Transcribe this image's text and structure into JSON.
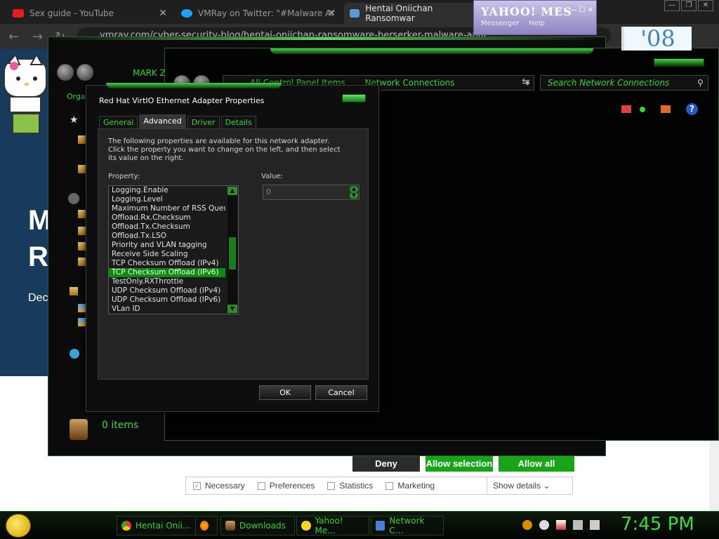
{
  "browser": {
    "tabs": [
      {
        "title": "Sex guide - YouTube",
        "icon": "youtube-icon",
        "active": false
      },
      {
        "title": "VMRay on Twitter: \"#Malware Ar",
        "icon": "twitter-icon",
        "active": false
      },
      {
        "title": "Hentai Oniichan Ransomwar",
        "icon": "vmray-icon",
        "active": true
      }
    ],
    "url": "vmray.com/cyber-security-blog/hentai-oniichan-ransomware-berserker-malware-anal"
  },
  "page": {
    "hero_letter_1": "M",
    "hero_letter_2": "R",
    "hero_sub": "Dec",
    "cookie": {
      "deny": "Deny",
      "allow_selection": "Allow selection",
      "allow_all": "Allow all",
      "checks": [
        {
          "label": "Necessary",
          "checked": true
        },
        {
          "label": "Preferences",
          "checked": false
        },
        {
          "label": "Statistics",
          "checked": false
        },
        {
          "label": "Marketing",
          "checked": false
        }
      ],
      "show_details": "Show details"
    }
  },
  "yahoo": {
    "brand": "YAHOO! MES",
    "messenger": "Messenger",
    "help": "Help",
    "badge": "'08"
  },
  "explorer_back": {
    "user_label": "MARK ZU",
    "organize": "Organ",
    "status": "0 items"
  },
  "explorer_front": {
    "breadcrumb": [
      "All Control Panel Items",
      "Network Connections"
    ],
    "search_placeholder": "Search Network Connections"
  },
  "dialog": {
    "title": "Red Hat VirtIO Ethernet Adapter Properties",
    "tabs": [
      "General",
      "Advanced",
      "Driver",
      "Details"
    ],
    "active_tab": "Advanced",
    "description": "The following properties are available for this network adapter. Click the property you want to change on the left, and then select its value on the right.",
    "property_label": "Property:",
    "value_label": "Value:",
    "properties": [
      "Logging.Enable",
      "Logging.Level",
      "Maximum Number of RSS Queues",
      "Offload.Rx.Checksum",
      "Offload.Tx.Checksum",
      "Offload.Tx.LSO",
      "Priority and VLAN tagging",
      "Receive Side Scaling",
      "TCP Checksum Offload (IPv4)",
      "TCP Checksum Offload (IPv6)",
      "TestOnly.RXThrottle",
      "UDP Checksum Offload (IPv4)",
      "UDP Checksum Offload (IPv6)",
      "VLan ID"
    ],
    "selected_property": "TCP Checksum Offload (IPv6)",
    "value": "0",
    "ok": "OK",
    "cancel": "Cancel"
  },
  "taskbar": {
    "items": [
      {
        "label": "Hentai Onii...",
        "icon": "chrome-icon"
      },
      {
        "label": "",
        "icon": "firefox-icon"
      },
      {
        "label": "Downloads",
        "icon": "downloads-icon"
      },
      {
        "label": "Yahoo! Me...",
        "icon": "yahoo-smiley-icon"
      },
      {
        "label": "Network C...",
        "icon": "network-icon"
      }
    ],
    "clock": "7:45 PM"
  },
  "colors": {
    "accent_green": "#3bd13b",
    "selection_green": "#0f8a0f",
    "cookie_green": "#19a319",
    "hero_blue": "#183a5c"
  }
}
